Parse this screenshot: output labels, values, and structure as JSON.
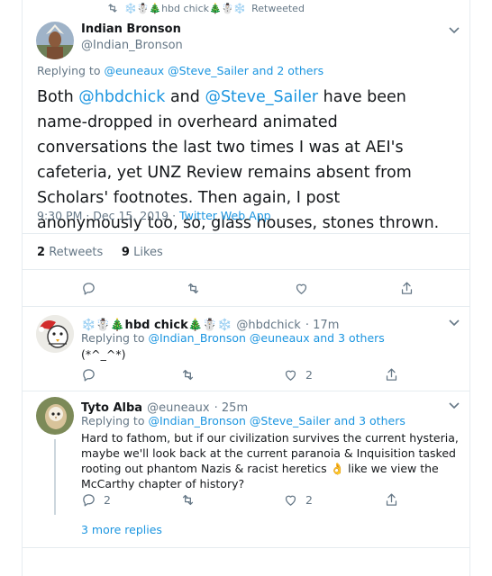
{
  "retweet_banner": {
    "name": "❄️☃️🎄hbd chick🎄☃️❄️",
    "label": "Retweeted"
  },
  "main_tweet": {
    "display_name": "Indian Bronson",
    "handle": "@Indian_Bronson",
    "replying_prefix": "Replying to",
    "replying_targets": "@euneaux @Steve_Sailer",
    "replying_suffix": "and 2 others",
    "text_parts": {
      "p1": "Both ",
      "m1": "@hbdchick",
      "p2": " and ",
      "m2": "@Steve_Sailer",
      "p3": " have been name-dropped in overheard animated conversations the last two times I was at AEI's cafeteria, yet UNZ Review remains absent from Scholars' footnotes. Then again, I post anonymously too, so, glass houses, stones thrown."
    },
    "timestamp": "9:30 PM · Dec 15, 2019",
    "separator": " · ",
    "source": "Twitter Web App",
    "retweets_count": "2",
    "retweets_label": "Retweets",
    "likes_count": "9",
    "likes_label": "Likes"
  },
  "replies": [
    {
      "display_name": "❄️☃️🎄hbd chick🎄☃️❄️",
      "handle": "@hbdchick",
      "time": "· 17m",
      "replying_prefix": "Replying to",
      "replying_targets": "@Indian_Bronson @euneaux",
      "replying_suffix": "and 3 others",
      "text": "(*^_^*)",
      "reply_count": "",
      "like_count": "2"
    },
    {
      "display_name": "Tyto Alba",
      "handle": "@euneaux",
      "time": "· 25m",
      "replying_prefix": "Replying to",
      "replying_targets": "@Indian_Bronson @Steve_Sailer",
      "replying_suffix": "and 3 others",
      "text": "Hard to fathom, but if our civilization survives the current hysteria, maybe we'll look back at the current paranoia & Inquisition tasked rooting out phantom Nazis & racist heretics 👌 like we view the McCarthy chapter of history?",
      "reply_count": "2",
      "like_count": "2"
    }
  ],
  "more_replies": "3 more replies",
  "colors": {
    "accent": "#1b95e0",
    "muted": "#657786",
    "text": "#14171a",
    "border": "#e6ecf0"
  },
  "icons": [
    "retweet-icon",
    "chevron-down-icon",
    "reply-icon",
    "like-icon",
    "share-icon"
  ]
}
